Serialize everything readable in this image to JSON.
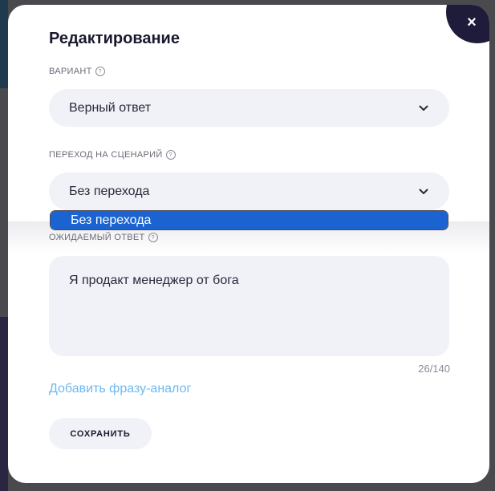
{
  "dialog": {
    "title": "Редактирование",
    "close_label": "×"
  },
  "variant": {
    "label": "ВАРИАНТ",
    "value": "Верный ответ"
  },
  "scenario": {
    "label": "ПЕРЕХОД НА СЦЕНАРИЙ",
    "value": "Без перехода",
    "options": [
      "Без перехода"
    ],
    "highlighted_option": "Без перехода"
  },
  "expected_answer": {
    "label": "ОЖИДАЕМЫЙ ОТВЕТ",
    "value": "Я продакт менеджер от бога",
    "counter": "26/140"
  },
  "add_phrase_link": "Добавить фразу-аналог",
  "save_button": "СОХРАНИТЬ",
  "icons": {
    "help": "help-circle-icon",
    "chevron": "chevron-down-icon",
    "close": "close-icon"
  },
  "colors": {
    "accent_link": "#6fb8f0",
    "dropdown_highlight": "#1a63d0",
    "field_bg": "#f1f1f8",
    "close_corner": "#1f1b3a"
  }
}
